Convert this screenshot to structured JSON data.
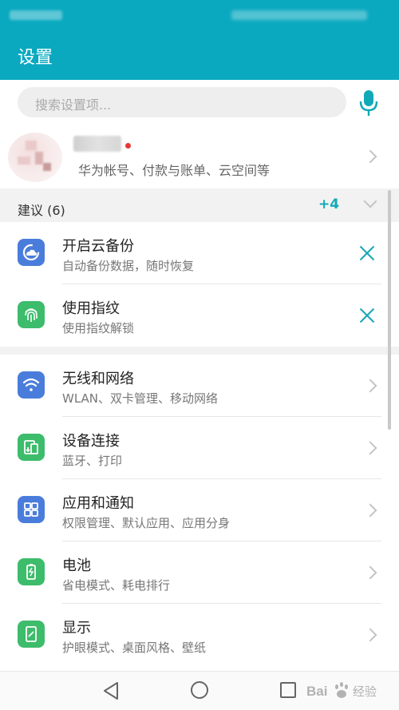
{
  "app": {
    "title": "设置",
    "accent_color": "#0aa9c0"
  },
  "search": {
    "placeholder": "搜索设置项...",
    "mic_icon": "mic-icon"
  },
  "account": {
    "subtitle": "华为帐号、付款与账单、云空间等"
  },
  "suggestions": {
    "header": "建议 (6)",
    "more_count": "+4",
    "items": [
      {
        "title": "开启云备份",
        "subtitle": "自动备份数据，随时恢复",
        "icon": "cloud-backup-icon",
        "icon_color": "#4a7ddb"
      },
      {
        "title": "使用指纹",
        "subtitle": "使用指纹解锁",
        "icon": "fingerprint-icon",
        "icon_color": "#3dbc6b"
      }
    ]
  },
  "settings": {
    "items": [
      {
        "title": "无线和网络",
        "subtitle": "WLAN、双卡管理、移动网络",
        "icon": "wifi-icon",
        "icon_color": "#4a7ddb"
      },
      {
        "title": "设备连接",
        "subtitle": "蓝牙、打印",
        "icon": "device-connect-icon",
        "icon_color": "#3dbc6b"
      },
      {
        "title": "应用和通知",
        "subtitle": "权限管理、默认应用、应用分身",
        "icon": "apps-icon",
        "icon_color": "#4a7ddb"
      },
      {
        "title": "电池",
        "subtitle": "省电模式、耗电排行",
        "icon": "battery-icon",
        "icon_color": "#3dbc6b"
      },
      {
        "title": "显示",
        "subtitle": "护眼模式、桌面风格、壁纸",
        "icon": "display-icon",
        "icon_color": "#3dbc6b"
      }
    ]
  },
  "navbar": {
    "back_icon": "back-icon",
    "home_icon": "home-icon",
    "recent_icon": "recent-apps-icon"
  },
  "watermark": {
    "text": "Bai 经验"
  }
}
